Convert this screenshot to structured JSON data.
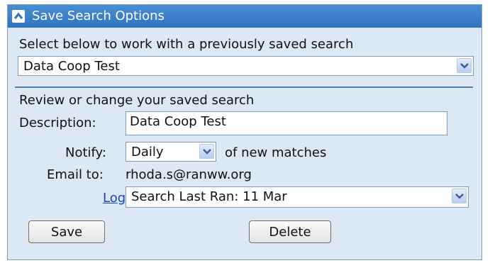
{
  "panel": {
    "title": "Save Search Options",
    "collapse_icon": "chevron-up-icon"
  },
  "saved_search": {
    "prompt": "Select below to work with a previously saved search",
    "selected": "Data Coop Test"
  },
  "review": {
    "heading": "Review or change your saved search",
    "description_label": "Description:",
    "description_value": "Data Coop Test",
    "notify_label": "Notify:",
    "notify_selected": "Daily",
    "notify_suffix": "of new matches",
    "email_label": "Email to:",
    "email_value": "rhoda.s@ranww.org",
    "log_link": "Log",
    "log_colon": ":",
    "log_selected": "Search Last Ran: 11 Mar"
  },
  "buttons": {
    "save": "Save",
    "delete": "Delete"
  },
  "colors": {
    "titlebar": "#2f74c2",
    "panel_background": "#dde8f5",
    "link": "#1a44c2"
  }
}
